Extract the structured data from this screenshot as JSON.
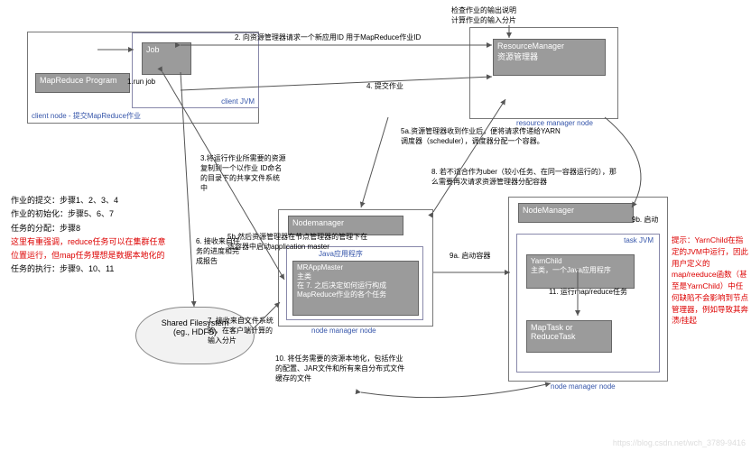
{
  "client": {
    "title": "client node - 提交MapReduce作业",
    "jvm_label": "client JVM",
    "mr_program": "MapReduce Program",
    "job": "Job",
    "run_job": "1.run job"
  },
  "rm": {
    "node": "resource manager node",
    "title": "ResourceManager",
    "sub": "资源管理器"
  },
  "nm1": {
    "node": "node manager node",
    "title": "Nodemanager",
    "mr_master": "MRAppMaster",
    "mr_master_sub": "主类",
    "mr_master_note": "在 7. 之后决定如何运行构成MapReduce作业的各个任务",
    "app_label": "Java应用程序"
  },
  "nm2": {
    "node": "node manager node",
    "title": "NodeManager",
    "task_jvm": "task JVM",
    "yarnchild": "YarnChild",
    "yarnchild_sub": "主类，一个Java应用程序",
    "task": "MapTask or ReduceTask"
  },
  "hdfs": "Shared Filesystem\n(eg., HDFS)",
  "arrows": {
    "a2": "2. 向资源管理器请求一个新应用ID     用于MapReduce作业ID",
    "a4": "4. 提交作业",
    "check": "检查作业的输出说明\n计算作业的输入分片",
    "a3": "3.将运行作业所需要的资源复制到一个以作业   ID命名的目录下的共享文件系统中",
    "a5b": "5b.然后资源管理器在节点管理器的管理下在该容器中启动application master",
    "a6": "6. 接收来自任务的进度和完成报告",
    "a7": "7. 接收来自文件系统的，在客户端计算的输入分片",
    "a5a": "5a.资源管理器收到作业后，便将请求传递给YARN调度器（scheduler），调度器分配一个容器。",
    "a8": "8. 若不适合作为uber（较小任务、在同一容器运行的），那么需要再次请求资源管理器分配容器",
    "a9a": "9a. 启动容器",
    "a9b": "9b. 启动",
    "a10": "10. 将任务需要的资源本地化，包括作业的配置、JAR文件和所有来自分布式文件缓存的文件",
    "a11": "11. 运行map/reduce任务"
  },
  "legend": {
    "l1": "作业的提交：步骤1、2、3、4",
    "l2": "作业的初始化：步骤5、6、7",
    "l3": "任务的分配：步骤8",
    "l4": "这里有重强调，reduce任务可以在集群任意位置运行，但map任务理想是数据本地化的",
    "l5": "任务的执行：步骤9、10、11"
  },
  "tip": "提示：YarnChild在指定的JVM中运行，因此用户定义的map/reeduce函数（甚至是YarnChild）中任何缺陷不会影响到节点管理器，例如导致其奔溃/挂起",
  "watermark": "https://blog.csdn.net/wch_3789-9416"
}
